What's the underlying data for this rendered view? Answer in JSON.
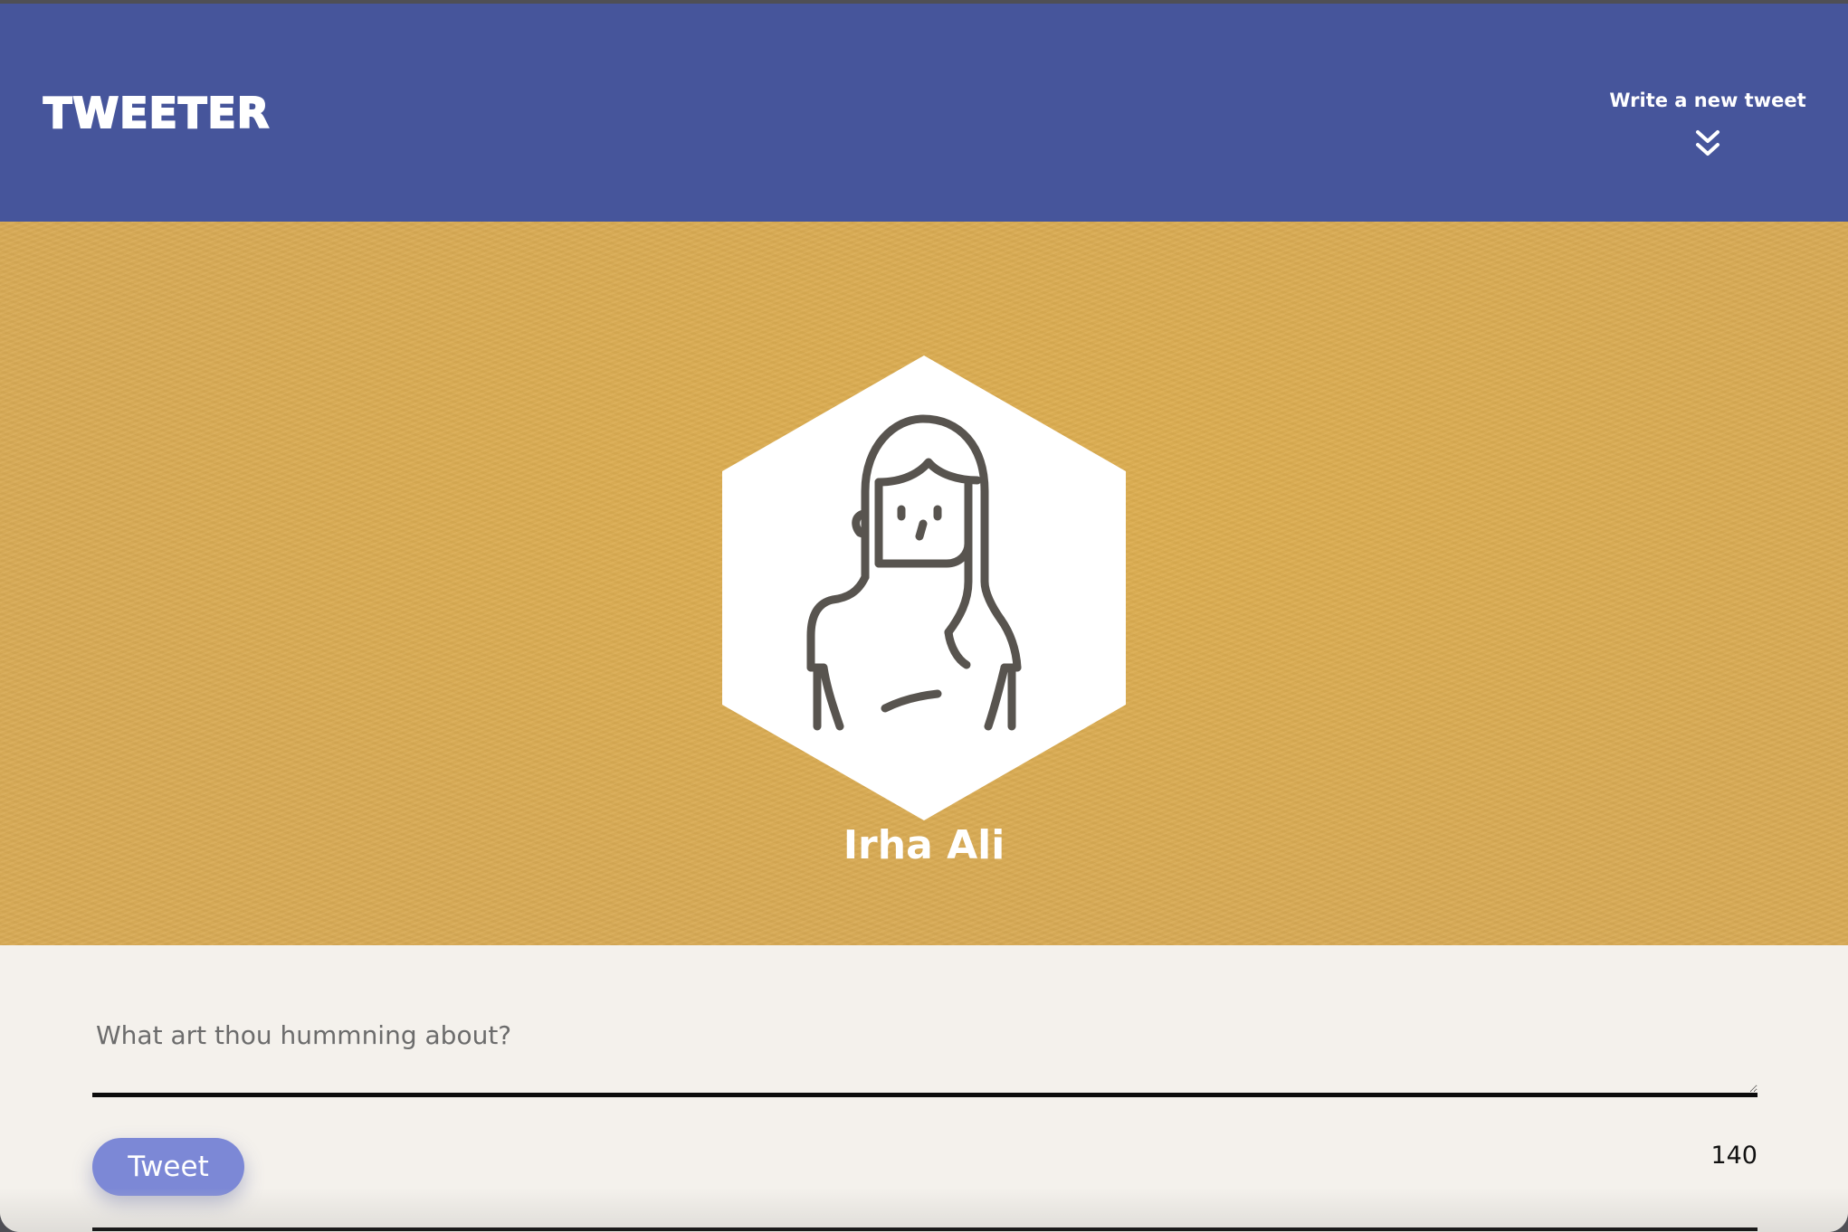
{
  "nav": {
    "brand": "TWEETER",
    "compose_toggle_label": "Write a new tweet",
    "compose_toggle_icon": "double-chevron-down-icon"
  },
  "profile": {
    "avatar_icon": "user-avatar-icon",
    "name": "Irha Ali",
    "background_color": "#d8aa55"
  },
  "compose": {
    "placeholder": "What art thou hummning about?",
    "value": "",
    "submit_label": "Tweet",
    "counter": "140"
  },
  "colors": {
    "nav_background": "#46559b",
    "button_background": "#7c88d6",
    "page_background": "#f4f1ec"
  }
}
